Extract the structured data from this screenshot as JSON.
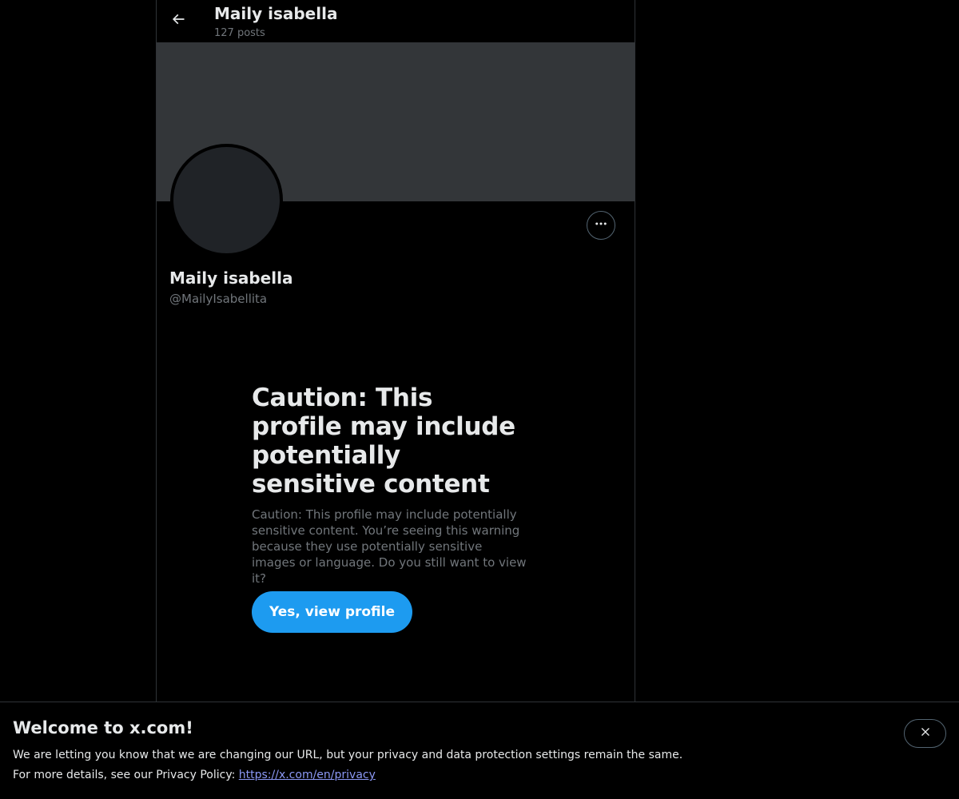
{
  "header": {
    "name": "Maily isabella",
    "posts": "127 posts",
    "back_icon": "arrow-left-icon"
  },
  "profile": {
    "name": "Maily isabella",
    "handle": "@MailyIsabellita",
    "more_icon": "ellipsis-icon"
  },
  "warning": {
    "title": "Caution: This profile may include potentially sensitive content",
    "text": "Caution: This profile may include potentially sensitive content. You’re seeing this warning because they use potentially sensitive images or language. Do you still want to view it?",
    "button_label": "Yes, view profile"
  },
  "notice": {
    "title": "Welcome to x.com!",
    "line1": "We are letting you know that we are changing our URL, but your privacy and data protection settings remain the same.",
    "line2_prefix": "For more details, see our Privacy Policy: ",
    "link": "https://x.com/en/privacy",
    "close_icon": "close-icon"
  },
  "colors": {
    "background": "#000000",
    "banner": "#333639",
    "accent": "#1d9bf0",
    "secondary_text": "#71767b",
    "link": "#8b98f5"
  }
}
